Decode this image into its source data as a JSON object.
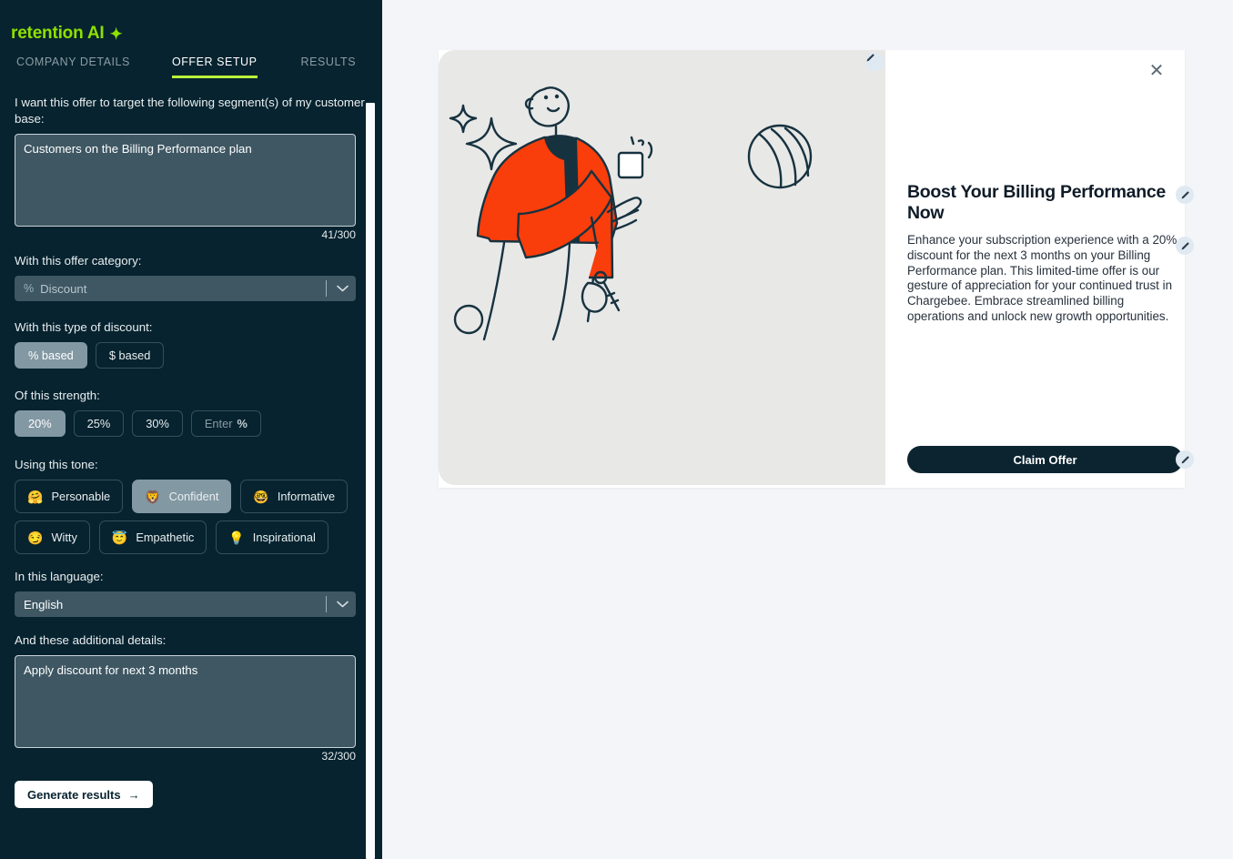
{
  "brand": {
    "name": "retention AI",
    "spark_icon": "sparkle-icon"
  },
  "tabs": [
    {
      "label": "COMPANY DETAILS",
      "active": false
    },
    {
      "label": "OFFER SETUP",
      "active": true
    },
    {
      "label": "RESULTS",
      "active": false
    }
  ],
  "form": {
    "segment": {
      "label": "I want this offer to target the following segment(s) of my customer base:",
      "value": "Customers on the Billing Performance plan",
      "placeholder": "",
      "counter": "41/300"
    },
    "category": {
      "label": "With this offer category:",
      "icon": "percent-icon",
      "value": "Discount",
      "caret_icon": "chevron-down-icon"
    },
    "discount_type": {
      "label": "With this type of discount:",
      "options": [
        {
          "label": "% based",
          "selected": true
        },
        {
          "label": "$ based",
          "selected": false
        }
      ]
    },
    "strength": {
      "label": "Of this strength:",
      "options": [
        {
          "label": "20%",
          "selected": true
        },
        {
          "label": "25%",
          "selected": false
        },
        {
          "label": "30%",
          "selected": false
        }
      ],
      "custom_placeholder": "Enter",
      "custom_suffix": "%"
    },
    "tone": {
      "label": "Using this tone:",
      "options": [
        {
          "label": "Personable",
          "emoji": "🤗",
          "icon": "hugging-face-emoji",
          "selected": false
        },
        {
          "label": "Confident",
          "emoji": "🦁",
          "icon": "lion-emoji",
          "selected": true
        },
        {
          "label": "Informative",
          "emoji": "🤓",
          "icon": "nerd-face-emoji",
          "selected": false
        },
        {
          "label": "Witty",
          "emoji": "😏",
          "icon": "smirking-face-emoji",
          "selected": false
        },
        {
          "label": "Empathetic",
          "emoji": "😇",
          "icon": "halo-face-emoji",
          "selected": false
        },
        {
          "label": "Inspirational",
          "emoji": "💡",
          "icon": "lightbulb-emoji",
          "selected": false
        }
      ]
    },
    "language": {
      "label": "In this language:",
      "value": "English",
      "caret_icon": "chevron-down-icon"
    },
    "details": {
      "label": "And these additional details:",
      "value": "Apply discount for next 3 months",
      "placeholder": "",
      "counter": "32/300"
    },
    "generate": {
      "label": "Generate results",
      "arrow": "→",
      "icon": "arrow-right-icon"
    }
  },
  "preview": {
    "close_icon": "close-icon",
    "edit_icon": "pencil-icon",
    "title": "Boost Your Billing Performance Now",
    "description": "Enhance your subscription experience with a 20% discount for the next 3 months on your Billing Performance plan. This limited-time offer is our gesture of appreciation for your continued trust in Chargebee. Embrace streamlined billing operations and unlock new growth opportunities.",
    "cta_label": "Claim Offer",
    "illustration_alt": "person-holding-phone-illustration"
  },
  "colors": {
    "sidebar_bg": "#06232f",
    "brand_green": "#8ee000",
    "tab_underline": "#bbf23c",
    "input_bg": "#3e5763",
    "selected_pill": "#8298a3",
    "page_bg": "#f4f5f8",
    "illustration_bg": "#e8e8e7",
    "cta_bg": "#0c2430",
    "accent_orange": "#f93d0b"
  }
}
